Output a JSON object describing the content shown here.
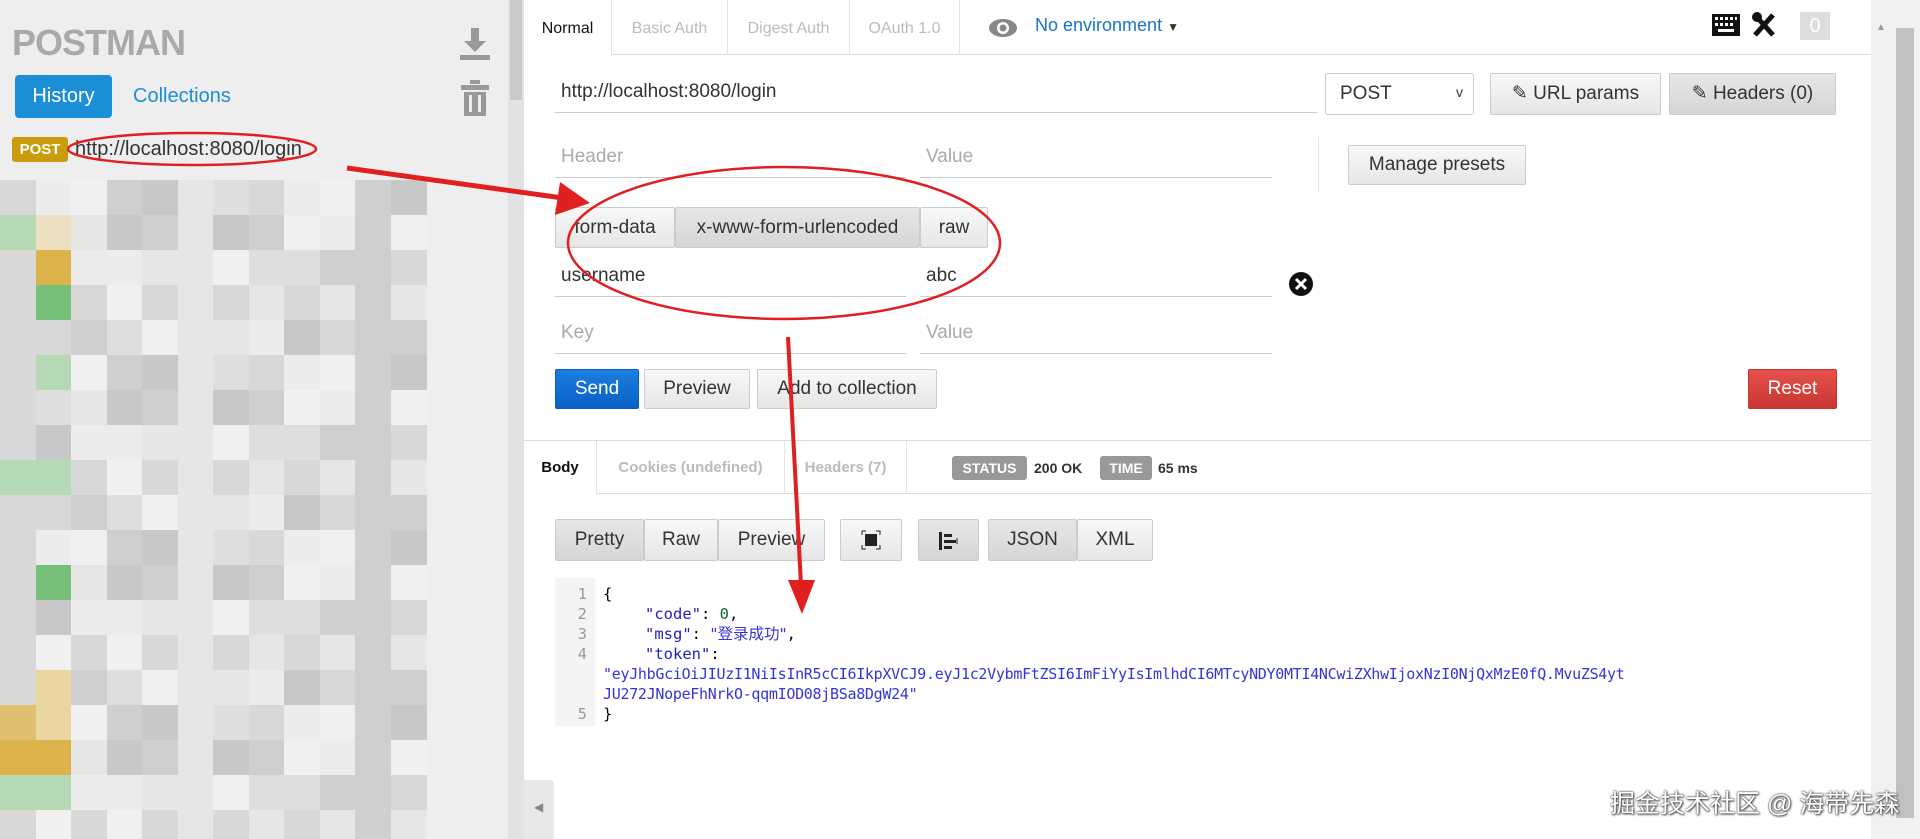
{
  "sidebar": {
    "logo": "POSTMAN",
    "history": "History",
    "collections": "Collections",
    "history_item": {
      "method": "POST",
      "url": "http://localhost:8080/login"
    }
  },
  "tabs": [
    "Normal",
    "Basic Auth",
    "Digest Auth",
    "OAuth 1.0"
  ],
  "environment": "No environment",
  "notifications": "0",
  "request": {
    "url": "http://localhost:8080/login",
    "method": "POST",
    "url_params": "URL params",
    "headers_btn": "Headers (0)",
    "header_placeholder": "Header",
    "value_placeholder": "Value",
    "manage_presets": "Manage presets",
    "body_types": [
      "form-data",
      "x-www-form-urlencoded",
      "raw"
    ],
    "params": [
      {
        "key": "username",
        "value": "abc"
      }
    ],
    "key_placeholder": "Key",
    "send": "Send",
    "preview": "Preview",
    "add_to_collection": "Add to collection",
    "reset": "Reset"
  },
  "response": {
    "tabs": [
      "Body",
      "Cookies (undefined)",
      "Headers (7)"
    ],
    "status_label": "STATUS",
    "status": "200 OK",
    "time_label": "TIME",
    "time": "65 ms",
    "view_modes": [
      "Pretty",
      "Raw",
      "Preview"
    ],
    "formats": [
      "JSON",
      "XML"
    ],
    "line_numbers": [
      "1",
      "2",
      "3",
      "4",
      "5"
    ],
    "code": {
      "open": "{",
      "code_key": "\"code\"",
      "code_val": "0",
      "msg_key": "\"msg\"",
      "msg_val": "\"登录成功\"",
      "token_key": "\"token\"",
      "token_line1": "\"eyJhbGciOiJIUzI1NiIsInR5cCI6IkpXVCJ9.eyJ1c2VybmFtZSI6ImFiYyIsImlhdCI6MTcyNDY0MTI4NCwiZXhwIjoxNzI0NjQxMzE0fQ.MvuZS4yt",
      "token_line2": "JU272JNopeFhNrkO-qqmIOD08jBSa8DgW24\"",
      "close": "}"
    }
  },
  "watermark": "掘金技术社区 @ 海带先森",
  "colors": {
    "accent": "#1a8fd8",
    "send": "#0d6fd6",
    "reset": "#d9413e",
    "post_badge": "#c99c0c",
    "annotation": "#e02020"
  }
}
